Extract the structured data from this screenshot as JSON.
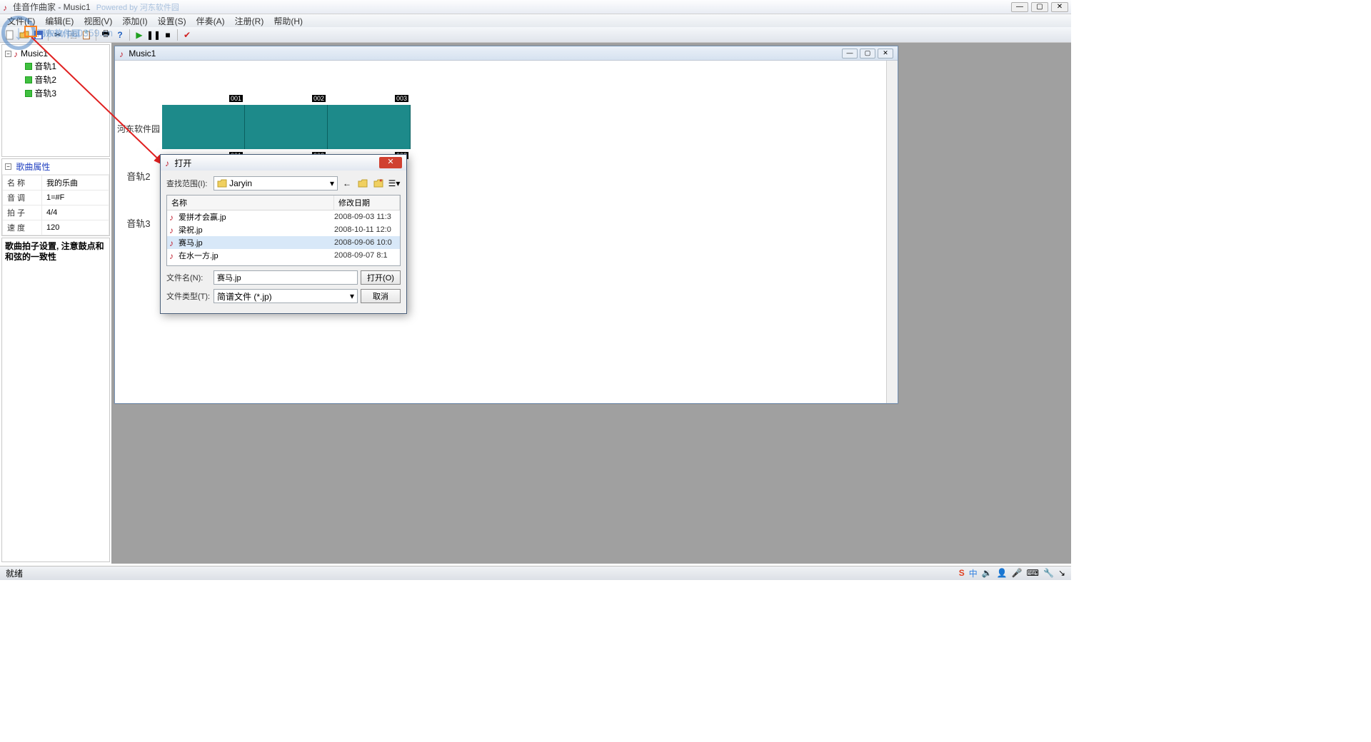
{
  "app": {
    "title": "佳音作曲家 - Music1",
    "extras": "Powered by 河东软件园"
  },
  "menu": [
    "文件(F)",
    "编辑(E)",
    "视图(V)",
    "添加(I)",
    "设置(S)",
    "伴奏(A)",
    "注册(R)",
    "帮助(H)"
  ],
  "tree": {
    "root": "Music1",
    "tracks": [
      "音轨1",
      "音轨2",
      "音轨3"
    ]
  },
  "props": {
    "title": "歌曲属性",
    "rows": [
      {
        "k": "名    称",
        "v": "我的乐曲"
      },
      {
        "k": "音    调",
        "v": "1=#F"
      },
      {
        "k": "拍    子",
        "v": "4/4"
      },
      {
        "k": "速    度",
        "v": "120"
      }
    ]
  },
  "help_text": "歌曲拍子设置, 注意鼓点和和弦的一致性",
  "doc": {
    "title": "Music1"
  },
  "track_labels": [
    "河东软件园",
    "音轨2",
    "音轨3"
  ],
  "markers_top": [
    "001",
    "002",
    "003"
  ],
  "markers_bot": [
    "001",
    "002",
    "003"
  ],
  "dialog": {
    "title": "打开",
    "look_in_label": "查找范围(I):",
    "folder": "Jaryin",
    "col_name": "名称",
    "col_date": "修改日期",
    "files": [
      {
        "n": "爱拼才会赢.jp",
        "d": "2008-09-03 11:3"
      },
      {
        "n": "梁祝.jp",
        "d": "2008-10-11 12:0"
      },
      {
        "n": "赛马.jp",
        "d": "2008-09-06 10:0"
      },
      {
        "n": "在水一方.jp",
        "d": "2008-09-07 8:1"
      }
    ],
    "filename_label": "文件名(N):",
    "filename_value": "赛马.jp",
    "filetype_label": "文件类型(T):",
    "filetype_value": "简谱文件 (*.jp)",
    "open_btn": "打开(O)",
    "cancel_btn": "取消"
  },
  "status": "就绪",
  "watermark_text": "河东软件园",
  "watermark_url": "www.pc0359.cn",
  "tray_text": "中"
}
